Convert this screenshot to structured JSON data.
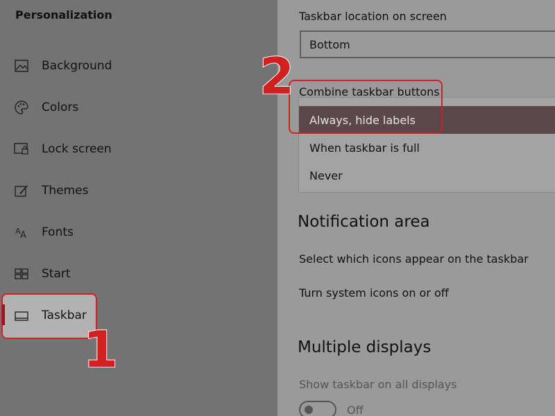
{
  "sidebar": {
    "title": "Personalization",
    "items": [
      {
        "label": "Background",
        "icon": "image-icon"
      },
      {
        "label": "Colors",
        "icon": "palette-icon"
      },
      {
        "label": "Lock screen",
        "icon": "lock-screen-icon"
      },
      {
        "label": "Themes",
        "icon": "themes-icon"
      },
      {
        "label": "Fonts",
        "icon": "fonts-icon"
      },
      {
        "label": "Start",
        "icon": "start-icon"
      },
      {
        "label": "Taskbar",
        "icon": "taskbar-icon",
        "selected": true
      }
    ]
  },
  "main": {
    "location": {
      "label": "Taskbar location on screen",
      "value": "Bottom"
    },
    "combine": {
      "label": "Combine taskbar buttons",
      "options": [
        "Always, hide labels",
        "When taskbar is full",
        "Never"
      ],
      "selected_index": 0
    },
    "notification": {
      "title": "Notification area",
      "links": [
        "Select which icons appear on the taskbar",
        "Turn system icons on or off"
      ]
    },
    "multiple": {
      "title": "Multiple displays",
      "show_label": "Show taskbar on all displays",
      "toggle_state": "Off"
    }
  },
  "annotations": {
    "step1": "1",
    "step2": "2"
  },
  "colors": {
    "highlight": "#d21f1f",
    "sidebar_bg": "#737373",
    "main_bg": "#9a9a9a",
    "selected_option": "#5a4749"
  }
}
